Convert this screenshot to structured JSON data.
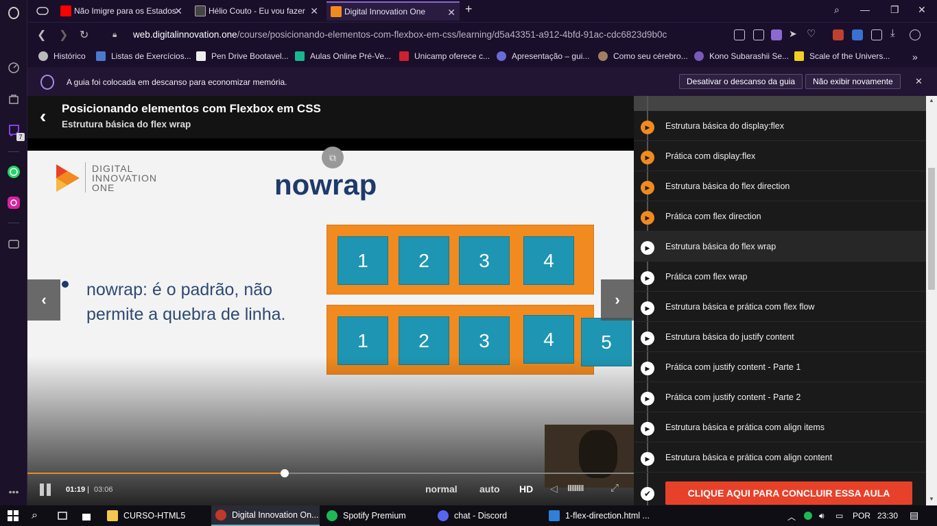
{
  "browser": {
    "tabs": [
      {
        "title": "Não Imigre para os Estados",
        "favicon_color": "#ff0000"
      },
      {
        "title": "Hélio Couto - Eu vou fazer",
        "favicon_color": "#333333"
      },
      {
        "title": "Digital Innovation One",
        "favicon_color": "#f18a1f"
      }
    ],
    "url_domain": "web.digitalinnovation.one",
    "url_path": "/course/posicionando-elementos-com-flexbox-em-css/learning/d5a43351-a912-4bfd-91ac-cdc6823d9b0c",
    "bookmarks": [
      {
        "label": "Histórico",
        "color": "#bbbbbb"
      },
      {
        "label": "Listas de Exercícios...",
        "color": "#4a7ad0"
      },
      {
        "label": "Pen Drive Bootavel...",
        "color": "#eeeeee"
      },
      {
        "label": "Aulas Online Pré-Ve...",
        "color": "#17b890"
      },
      {
        "label": "Unicamp oferece c...",
        "color": "#d02030"
      },
      {
        "label": "Apresentação – gui...",
        "color": "#6a6ad8"
      },
      {
        "label": "Como seu cérebro...",
        "color": "#a08060"
      },
      {
        "label": "Kono Subarashii Se...",
        "color": "#7a5ab8"
      },
      {
        "label": "Scale of the Univers...",
        "color": "#f0d020"
      }
    ],
    "infobar": {
      "message": "A guia foi colocada em descanso para economizar memória.",
      "disable_label": "Desativar o descanso da guia",
      "dismiss_label": "Não exibir novamente"
    },
    "sidebar_badge": "7"
  },
  "course": {
    "title": "Posicionando elementos com Flexbox em CSS",
    "subtitle": "Estrutura básica do flex wrap"
  },
  "slide": {
    "logo_lines": [
      "DIGITAL",
      "INNOVATION",
      "ONE"
    ],
    "heading": "nowrap",
    "bullet_text": "nowrap: é o padrão, não permite a quebra de linha.",
    "row1": [
      "1",
      "2",
      "3",
      "4"
    ],
    "row2": [
      "1",
      "2",
      "3",
      "4",
      "5"
    ]
  },
  "player": {
    "current_time": "01:19",
    "separator": "|",
    "duration": "03:06",
    "progress_fraction": 0.424,
    "speed_label": "normal",
    "quality_auto": "auto",
    "quality_hd": "HD",
    "volume_bars": "IIIIIIIII"
  },
  "playlist": {
    "items": [
      {
        "label": "Estrutura básica do display:flex",
        "state": "done"
      },
      {
        "label": "Prática com display:flex",
        "state": "done"
      },
      {
        "label": "Estrutura básica do flex direction",
        "state": "done"
      },
      {
        "label": "Prática com flex direction",
        "state": "done"
      },
      {
        "label": "Estrutura básica do flex wrap",
        "state": "current"
      },
      {
        "label": "Prática com flex wrap",
        "state": "todo"
      },
      {
        "label": "Estrutura básica e prática com flex flow",
        "state": "todo"
      },
      {
        "label": "Estrutura básica do justify content",
        "state": "todo"
      },
      {
        "label": "Prática com justify content - Parte 1",
        "state": "todo"
      },
      {
        "label": "Prática com justify content - Parte 2",
        "state": "todo"
      },
      {
        "label": "Estrutura básica e prática com align items",
        "state": "todo"
      },
      {
        "label": "Estrutura básica e prática com align content",
        "state": "todo"
      }
    ],
    "finish_label": "CLIQUE AQUI PARA CONCLUIR ESSA AULA",
    "accent": "#f18a1f"
  },
  "taskbar": {
    "items": [
      {
        "label": "CURSO-HTML5",
        "color": "#f3c74d"
      },
      {
        "label": "Digital Innovation On...",
        "color": "#c0392b"
      },
      {
        "label": "Spotify Premium",
        "color": "#1db954"
      },
      {
        "label": "chat - Discord",
        "color": "#5865f2"
      },
      {
        "label": "1-flex-direction.html ...",
        "color": "#2f80d8"
      }
    ],
    "language": "POR",
    "clock": "23:30"
  }
}
